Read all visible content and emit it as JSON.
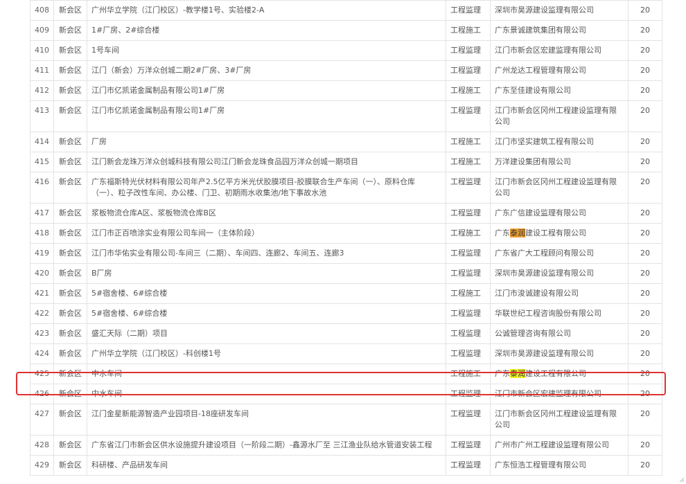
{
  "table": {
    "rows": [
      {
        "no": "408",
        "area": "新会区",
        "project": "广州华立学院（江门校区）-教学楼1号、实验楼2-A",
        "type": "工程监理",
        "company": "深圳市昊源建设监理有限公司",
        "score": "20"
      },
      {
        "no": "409",
        "area": "新会区",
        "project": "1#厂房、2#综合楼",
        "type": "工程施工",
        "company": "广东景诚建筑集团有限公司",
        "score": "20"
      },
      {
        "no": "410",
        "area": "新会区",
        "project": "1号车间",
        "type": "工程监理",
        "company": "江门市新会区宏建监理有限公司",
        "score": "20"
      },
      {
        "no": "411",
        "area": "新会区",
        "project": "江门（新会）万洋众创城二期2#厂房、3#厂房",
        "type": "工程监理",
        "company": "广州龙达工程管理有限公司",
        "score": "20"
      },
      {
        "no": "412",
        "area": "新会区",
        "project": "江门市亿凯诺金属制品有限公司1#厂房",
        "type": "工程施工",
        "company": "广东至佳建设有限公司",
        "score": "20"
      },
      {
        "no": "413",
        "area": "新会区",
        "project": "江门市亿凯诺金属制品有限公司1#厂房",
        "type": "工程监理",
        "company": "江门市新会区冈州工程建设监理有限公司",
        "score": "20"
      },
      {
        "no": "414",
        "area": "新会区",
        "project": "厂房",
        "type": "工程施工",
        "company": "江门市坚实建筑工程有限公司",
        "score": "20"
      },
      {
        "no": "415",
        "area": "新会区",
        "project": "江门新会龙珠万洋众创城科技有限公司江门新会龙珠食品园万洋众创城一期项目",
        "type": "工程施工",
        "company": "万洋建设集团有限公司",
        "score": "20"
      },
      {
        "no": "416",
        "area": "新会区",
        "project": "广东福斯特光伏材料有限公司年产2.5亿平方米光伏胶膜项目-胶膜联合生产车间（一）、原料仓库（一）、粒子改性车间、办公楼、门卫、初期雨水收集池/地下事故水池",
        "type": "工程监理",
        "company": "江门市新会区冈州工程建设监理有限公司",
        "score": "20"
      },
      {
        "no": "417",
        "area": "新会区",
        "project": "浆板物流仓库A区、浆板物流仓库B区",
        "type": "工程监理",
        "company": "广东广信建设监理有限公司",
        "score": "20"
      },
      {
        "no": "418",
        "area": "新会区",
        "project": "江门市正百喷涂实业有限公司车间一（主体阶段）",
        "type": "工程施工",
        "company_pre": "广东",
        "company_hl": "泰润",
        "company_post": "建设工程有限公司",
        "score": "20"
      },
      {
        "no": "419",
        "area": "新会区",
        "project": "江门市华佑实业有限公司-车间三（二期）、车间四、连廊2、车间五、连廊3",
        "type": "工程监理",
        "company": "广东省广大工程顾问有限公司",
        "score": "20"
      },
      {
        "no": "420",
        "area": "新会区",
        "project": "B厂房",
        "type": "工程监理",
        "company": "深圳市昊源建设监理有限公司",
        "score": "20"
      },
      {
        "no": "421",
        "area": "新会区",
        "project": "5#宿舍楼、6#综合楼",
        "type": "工程施工",
        "company": "江门市浚诚建设有限公司",
        "score": "20"
      },
      {
        "no": "422",
        "area": "新会区",
        "project": "5#宿舍楼、6#综合楼",
        "type": "工程监理",
        "company": "华联世纪工程咨询股份有限公司",
        "score": "20"
      },
      {
        "no": "423",
        "area": "新会区",
        "project": "盛汇天际（二期）项目",
        "type": "工程监理",
        "company": "公诚管理咨询有限公司",
        "score": "20"
      },
      {
        "no": "424",
        "area": "新会区",
        "project": "广州华立学院（江门校区）-科创楼1号",
        "type": "工程监理",
        "company": "深圳市昊源建设监理有限公司",
        "score": "20"
      },
      {
        "no": "425",
        "area": "新会区",
        "project": "中水车间",
        "type": "工程施工",
        "company_pre": "广东",
        "company_hl": "泰润",
        "company_post": "建设工程有限公司",
        "score": "20"
      },
      {
        "no": "426",
        "area": "新会区",
        "project": "中水车间",
        "type": "工程监理",
        "company": "江门市新会区宏建监理有限公司",
        "score": "20"
      },
      {
        "no": "427",
        "area": "新会区",
        "project": "江门金星新能源智造产业园项目-18座研发车间",
        "type": "工程监理",
        "company": "江门市新会区冈州工程建设监理有限公司",
        "score": "20"
      },
      {
        "no": "428",
        "area": "新会区",
        "project": "广东省江门市新会区供水设施提升建设项目（一阶段二期）-鑫源水厂至 三江渔业队给水管道安装工程",
        "type": "工程监理",
        "company": "广州市广州工程建设监理有限公司",
        "score": "20"
      },
      {
        "no": "429",
        "area": "新会区",
        "project": "科研楼、产品研发车间",
        "type": "工程监理",
        "company": "广东恒浩工程管理有限公司",
        "score": "20"
      }
    ]
  }
}
